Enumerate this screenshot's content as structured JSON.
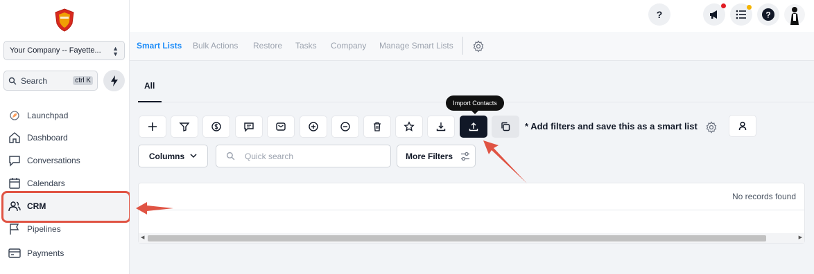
{
  "sidebar": {
    "company": "Your Company -- Fayette...",
    "search_label": "Search",
    "search_shortcut": "ctrl K",
    "items": [
      {
        "label": "Launchpad"
      },
      {
        "label": "Dashboard"
      },
      {
        "label": "Conversations"
      },
      {
        "label": "Calendars"
      },
      {
        "label": "CRM"
      },
      {
        "label": "Pipelines"
      },
      {
        "label": "Payments"
      }
    ]
  },
  "topbar": {
    "help_label": "?"
  },
  "tabs": [
    "Smart Lists",
    "Bulk Actions",
    "Restore",
    "Tasks",
    "Company",
    "Manage Smart Lists"
  ],
  "subtab": "All",
  "toolbar": {
    "tooltip": "Import Contacts",
    "hint": "* Add filters and save this as a smart list",
    "columns_label": "Columns",
    "quick_search_placeholder": "Quick search",
    "more_filters_label": "More Filters"
  },
  "table": {
    "empty_text": "No records found"
  },
  "colors": {
    "accent": "#1d8cf8",
    "highlight": "#e05444",
    "dark": "#111827"
  }
}
